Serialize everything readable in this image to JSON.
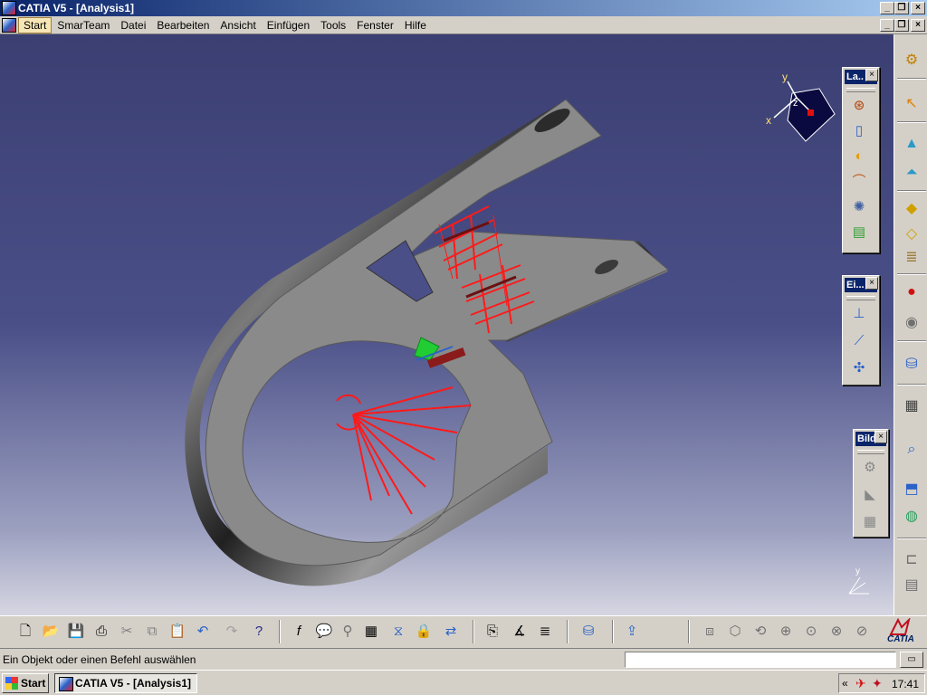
{
  "window": {
    "title": "CATIA V5 - [Analysis1]"
  },
  "menu": {
    "items": [
      {
        "label": "Start"
      },
      {
        "label": "SmarTeam"
      },
      {
        "label": "Datei"
      },
      {
        "label": "Bearbeiten"
      },
      {
        "label": "Ansicht"
      },
      {
        "label": "Einfügen"
      },
      {
        "label": "Tools"
      },
      {
        "label": "Fenster"
      },
      {
        "label": "Hilfe"
      }
    ]
  },
  "compass": {
    "axis_y": "y",
    "axis_x": "x",
    "axis_z": "z"
  },
  "floating_toolbars": {
    "loads": {
      "title": "La..",
      "close": "×"
    },
    "restraints": {
      "title": "Ei...",
      "close": "×"
    },
    "image": {
      "title": "Bild",
      "close": "×"
    }
  },
  "axis_triad": {
    "label_y": "y"
  },
  "status": {
    "message": "Ein Objekt oder einen Befehl auswählen",
    "command_placeholder": ""
  },
  "taskbar": {
    "start_label": "Start",
    "task_label": "CATIA V5 - [Analysis1]",
    "tray_chevron": "«",
    "clock": "17:41"
  },
  "brand": {
    "logo_text": "CATIA"
  },
  "colors": {
    "titlebar_start": "#0a246a",
    "viewport_top": "#3b3f72",
    "part_gray": "#8a8a8a",
    "load_red": "#ff1a1a",
    "marker_green": "#22cc33",
    "menu_active": "#f7e6b5"
  }
}
